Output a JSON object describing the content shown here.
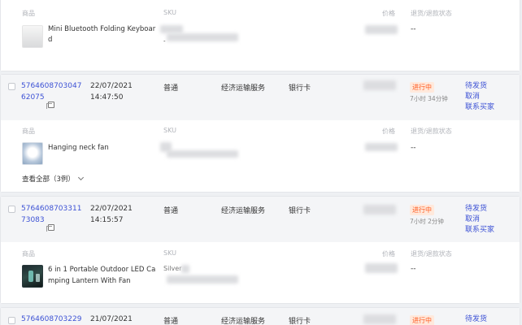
{
  "labels": {
    "product": "商品",
    "sku": "SKU",
    "price": "价格",
    "refund_status": "退货/退款状态",
    "dash": "--"
  },
  "colors": {
    "link": "#3d52d5",
    "status": "#ff5a1f",
    "status_bg": "#ffe9dc",
    "page_bg": "#eef0f3"
  },
  "top_item": {
    "name_line1": "Mini Bluetooth Folding Keyboar",
    "name_line2": "d",
    "sku_partial": "-"
  },
  "orders": [
    {
      "id_line1": "5764608703047",
      "id_line2": "62075",
      "date": "22/07/2021",
      "time": "14:47:50",
      "type": "普通",
      "shipping": "经济运输服务",
      "payment": "银行卡",
      "status": "进行中",
      "timer": "7小时 34分钟",
      "actions": [
        "待发货",
        "取消",
        "联系买家"
      ],
      "item": {
        "name": "Hanging neck fan",
        "sku_partial": "",
        "show_all": "查看全部（3例）"
      }
    },
    {
      "id_line1": "5764608703311",
      "id_line2": "73083",
      "date": "22/07/2021",
      "time": "14:15:57",
      "type": "普通",
      "shipping": "经济运输服务",
      "payment": "银行卡",
      "status": "进行中",
      "timer": "7小时 2分钟",
      "actions": [
        "待发货",
        "取消",
        "联系买家"
      ],
      "item": {
        "name_line1": "6 in 1 Portable Outdoor LED Ca",
        "name_line2": "mping Lantern With Fan",
        "sku_partial": "Silver"
      }
    },
    {
      "id_line1": "5764608703229",
      "date": "21/07/2021",
      "type": "普通",
      "shipping": "经济运输服务",
      "payment": "银行卡",
      "status": "进行中",
      "actions": [
        "待发货"
      ]
    }
  ]
}
